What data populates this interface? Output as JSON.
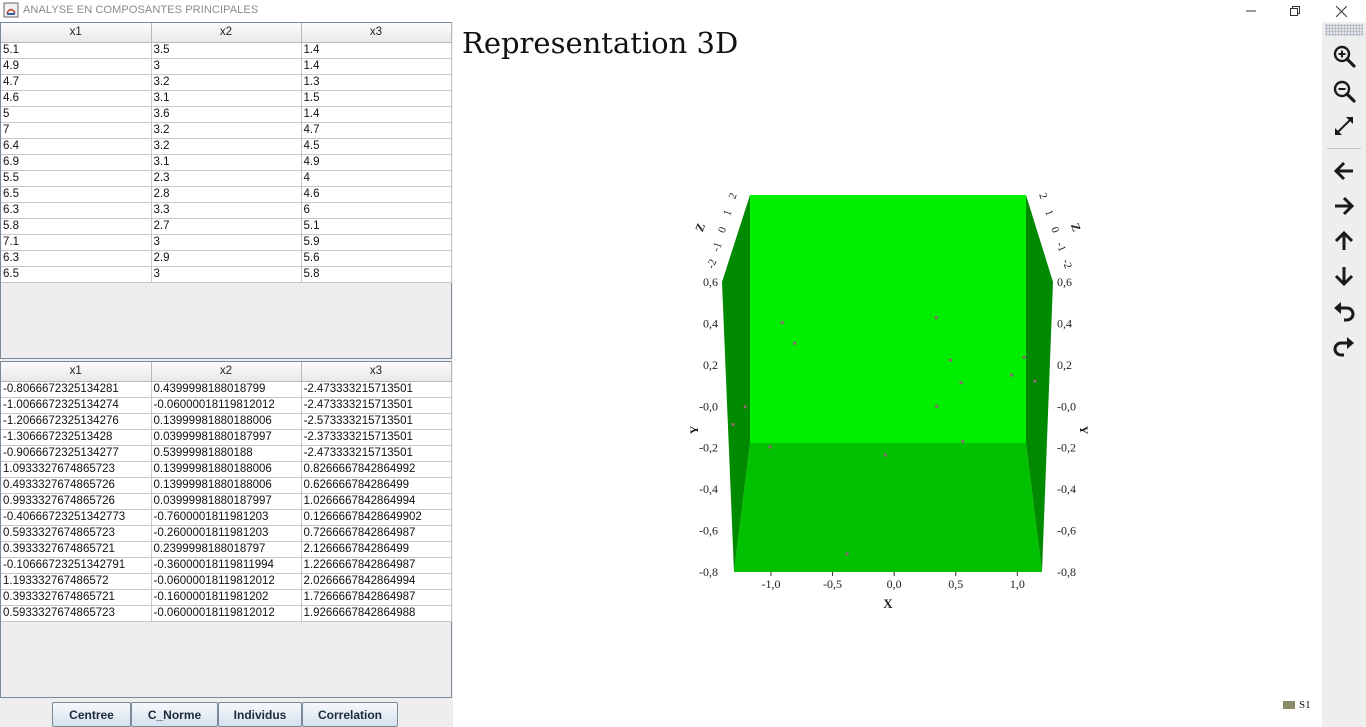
{
  "window": {
    "title": "ANALYSE EN COMPOSANTES PRINCIPALES"
  },
  "table_original": {
    "columns": [
      "x1",
      "x2",
      "x3"
    ],
    "rows": [
      [
        "5.1",
        "3.5",
        "1.4"
      ],
      [
        "4.9",
        "3",
        "1.4"
      ],
      [
        "4.7",
        "3.2",
        "1.3"
      ],
      [
        "4.6",
        "3.1",
        "1.5"
      ],
      [
        "5",
        "3.6",
        "1.4"
      ],
      [
        "7",
        "3.2",
        "4.7"
      ],
      [
        "6.4",
        "3.2",
        "4.5"
      ],
      [
        "6.9",
        "3.1",
        "4.9"
      ],
      [
        "5.5",
        "2.3",
        "4"
      ],
      [
        "6.5",
        "2.8",
        "4.6"
      ],
      [
        "6.3",
        "3.3",
        "6"
      ],
      [
        "5.8",
        "2.7",
        "5.1"
      ],
      [
        "7.1",
        "3",
        "5.9"
      ],
      [
        "6.3",
        "2.9",
        "5.6"
      ],
      [
        "6.5",
        "3",
        "5.8"
      ]
    ]
  },
  "table_centered": {
    "columns": [
      "x1",
      "x2",
      "x3"
    ],
    "rows": [
      [
        "-0.8066672325134281",
        "0.4399998188018799",
        "-2.473333215713501"
      ],
      [
        "-1.0066672325134274",
        "-0.06000018119812012",
        "-2.473333215713501"
      ],
      [
        "-1.2066672325134276",
        "0.13999981880188006",
        "-2.573333215713501"
      ],
      [
        "-1.306667232513428",
        "0.03999981880187997",
        "-2.373333215713501"
      ],
      [
        "-0.9066672325134277",
        "0.53999981880188",
        "-2.473333215713501"
      ],
      [
        "1.0933327674865723",
        "0.13999981880188006",
        "0.8266667842864992"
      ],
      [
        "0.4933327674865726",
        "0.13999981880188006",
        "0.626666784286499"
      ],
      [
        "0.9933327674865726",
        "0.03999981880187997",
        "1.0266667842864994"
      ],
      [
        "-0.40666723251342773",
        "-0.7600001811981203",
        "0.12666678428649902"
      ],
      [
        "0.5933327674865723",
        "-0.2600001811981203",
        "0.7266667842864987"
      ],
      [
        "0.3933327674865721",
        "0.2399998188018797",
        "2.126666784286499"
      ],
      [
        "-0.10666723251342791",
        "-0.36000018119811994",
        "1.2266667842864987"
      ],
      [
        "1.193332767486572",
        "-0.06000018119812012",
        "2.0266667842864994"
      ],
      [
        "0.3933327674865721",
        "-0.1600001811981202",
        "1.7266667842864987"
      ],
      [
        "0.5933327674865723",
        "-0.06000018119812012",
        "1.9266667842864988"
      ]
    ]
  },
  "buttons": {
    "centree": "Centree",
    "c_norme": "C_Norme",
    "individus": "Individus",
    "correlation": "Correlation"
  },
  "chart_data": {
    "type": "scatter",
    "title": "Representation 3D",
    "xlabel": "X",
    "ylabel": "Y",
    "zlabel": "Z",
    "xlim": [
      -1.3,
      1.2
    ],
    "ylim": [
      -0.8,
      0.6
    ],
    "zlim": [
      -2.6,
      2.2
    ],
    "x_ticks": [
      "-1,0",
      "-0,5",
      "0,0",
      "0,5",
      "1,0"
    ],
    "x_tick_values": [
      -1.0,
      -0.5,
      0.0,
      0.5,
      1.0
    ],
    "y_ticks": [
      "0,6",
      "0,4",
      "0,2",
      "-0,0",
      "-0,2",
      "-0,4",
      "-0,6",
      "-0,8"
    ],
    "y_tick_values": [
      0.6,
      0.4,
      0.2,
      0.0,
      -0.2,
      -0.4,
      -0.6,
      -0.8
    ],
    "z_ticks": [
      "-2",
      "-1",
      "0",
      "1",
      "2"
    ],
    "floor_color": "#00c000",
    "wall_back_color": "#00ee00",
    "wall_side_color": "#008a00",
    "point_color": "#8a6a6a",
    "series": [
      {
        "name": "S1",
        "points": [
          {
            "x": -0.81,
            "y": 0.44,
            "z": -2.47
          },
          {
            "x": -1.01,
            "y": -0.06,
            "z": -2.47
          },
          {
            "x": -1.21,
            "y": 0.14,
            "z": -2.57
          },
          {
            "x": -1.31,
            "y": 0.04,
            "z": -2.37
          },
          {
            "x": -0.91,
            "y": 0.54,
            "z": -2.47
          },
          {
            "x": 1.09,
            "y": 0.14,
            "z": 0.83
          },
          {
            "x": 0.49,
            "y": 0.14,
            "z": 0.63
          },
          {
            "x": 0.99,
            "y": 0.04,
            "z": 1.03
          },
          {
            "x": -0.41,
            "y": -0.76,
            "z": 0.13
          },
          {
            "x": 0.59,
            "y": -0.26,
            "z": 0.73
          },
          {
            "x": 0.39,
            "y": 0.24,
            "z": 2.13
          },
          {
            "x": -0.11,
            "y": -0.36,
            "z": 1.23
          },
          {
            "x": 1.19,
            "y": -0.06,
            "z": 2.03
          },
          {
            "x": 0.39,
            "y": -0.16,
            "z": 1.73
          },
          {
            "x": 0.59,
            "y": -0.06,
            "z": 1.93
          }
        ]
      }
    ]
  },
  "legend": {
    "label": "S1",
    "swatch_color": "#8a8a6a"
  },
  "toolbar": {
    "icons": [
      "zoom-in-icon",
      "zoom-out-icon",
      "fit-to-window-icon",
      "arrow-left-icon",
      "arrow-right-icon",
      "arrow-up-icon",
      "arrow-down-icon",
      "undo-icon",
      "redo-icon"
    ]
  }
}
